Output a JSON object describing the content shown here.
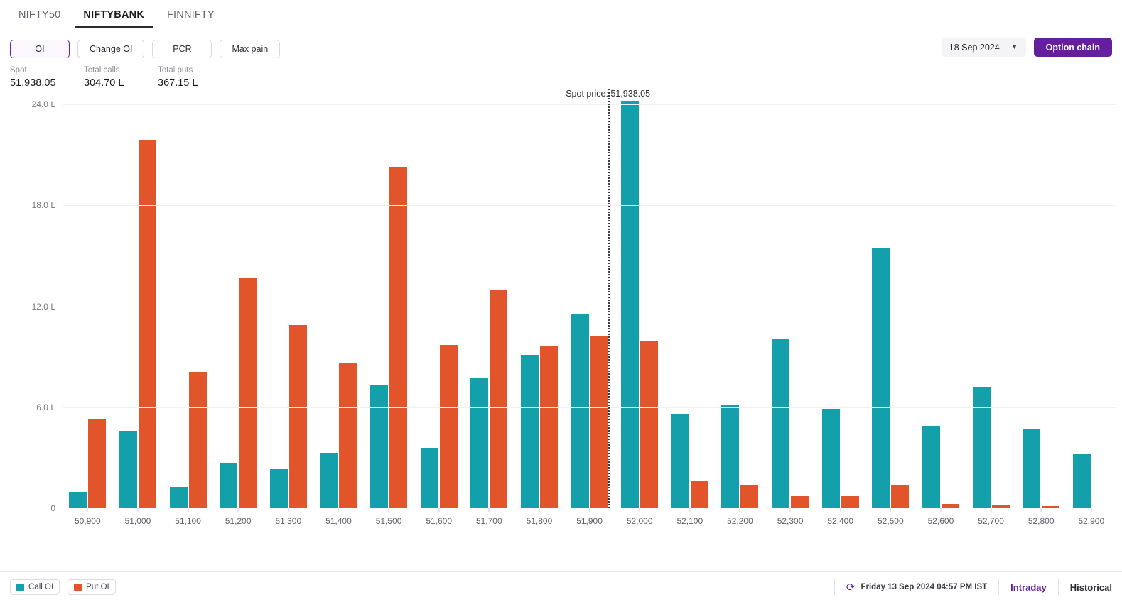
{
  "tabs": [
    {
      "label": "NIFTY50",
      "active": false
    },
    {
      "label": "NIFTYBANK",
      "active": true
    },
    {
      "label": "FINNIFTY",
      "active": false
    }
  ],
  "view_buttons": [
    {
      "label": "OI",
      "selected": true
    },
    {
      "label": "Change OI",
      "selected": false
    },
    {
      "label": "PCR",
      "selected": false
    },
    {
      "label": "Max pain",
      "selected": false
    }
  ],
  "expiry": {
    "value": "18 Sep 2024",
    "chevron": "chevron-down-icon"
  },
  "option_chain_button": {
    "label": "Option chain"
  },
  "stats": [
    {
      "label": "Spot",
      "value": "51,938.05"
    },
    {
      "label": "Total calls",
      "value": "304.70 L"
    },
    {
      "label": "Total puts",
      "value": "367.15 L"
    }
  ],
  "footer": {
    "legend": [
      {
        "label": "Call OI",
        "color": "#14a0ab"
      },
      {
        "label": "Put OI",
        "color": "#e2552a"
      }
    ],
    "refresh_icon": "refresh-icon",
    "timestamp": "Friday 13 Sep 2024 04:57 PM IST",
    "links": [
      {
        "label": "Intraday",
        "active": true
      },
      {
        "label": "Historical",
        "active": false
      }
    ]
  },
  "chart_data": {
    "type": "bar",
    "title": "",
    "xlabel": "",
    "ylabel": "",
    "ylim": [
      0,
      24
    ],
    "yticks": [
      "0",
      "6.0 L",
      "12.0 L",
      "18.0 L",
      "24.0 L"
    ],
    "ytick_values": [
      0,
      6,
      12,
      18,
      24
    ],
    "grid": true,
    "legend_position": "bottom-left",
    "unit": "L (lakh)",
    "categories": [
      "50,900",
      "51,000",
      "51,100",
      "51,200",
      "51,300",
      "51,400",
      "51,500",
      "51,600",
      "51,700",
      "51,800",
      "51,900",
      "52,000",
      "52,100",
      "52,200",
      "52,300",
      "52,400",
      "52,500",
      "52,600",
      "52,700",
      "52,800",
      "52,900"
    ],
    "series": [
      {
        "name": "Call OI",
        "color": "#14a0ab",
        "values": [
          0.95,
          4.6,
          1.25,
          2.7,
          2.3,
          3.3,
          7.3,
          3.6,
          7.75,
          9.1,
          11.5,
          24.2,
          5.6,
          6.1,
          10.1,
          5.9,
          15.5,
          4.9,
          7.2,
          4.7,
          3.25
        ]
      },
      {
        "name": "Put OI",
        "color": "#e2552a",
        "values": [
          5.3,
          21.9,
          8.1,
          13.7,
          10.9,
          8.6,
          20.3,
          9.7,
          13.0,
          9.6,
          10.2,
          9.9,
          1.6,
          1.4,
          0.75,
          0.7,
          1.4,
          0.25,
          0.15,
          0.12,
          0.04
        ]
      }
    ],
    "annotations": [
      {
        "name": "spot-price-line",
        "label": "Spot price: 51,938.05",
        "x_value": 51938.05
      }
    ]
  }
}
